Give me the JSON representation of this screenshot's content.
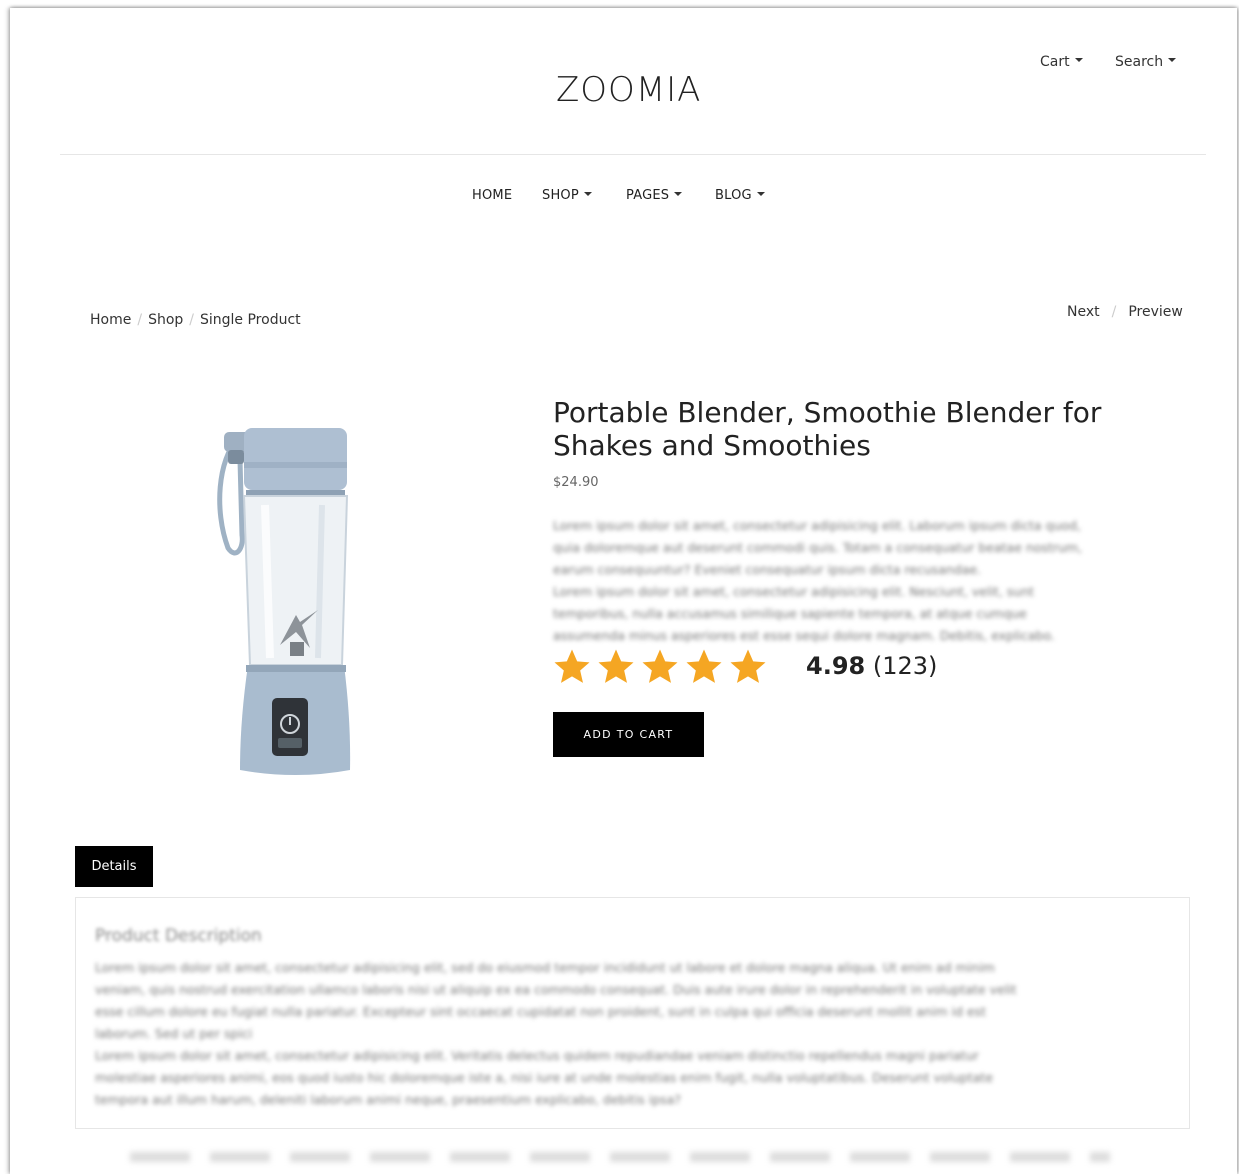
{
  "header": {
    "logo": "ZOOMIA",
    "cart_label": "Cart",
    "search_label": "Search"
  },
  "nav": {
    "items": [
      {
        "label": "HOME",
        "dropdown": false
      },
      {
        "label": "SHOP",
        "dropdown": true
      },
      {
        "label": "PAGES",
        "dropdown": true
      },
      {
        "label": "BLOG",
        "dropdown": true
      }
    ]
  },
  "breadcrumb": [
    "Home",
    "Shop",
    "Single Product"
  ],
  "pager": {
    "next": "Next",
    "prev": "Preview"
  },
  "product": {
    "title": "Portable Blender, Smoothie Blender for Shakes and Smoothies",
    "price": "$24.90",
    "description": [
      "Lorem ipsum dolor sit amet, consectetur adipisicing elit. Laborum ipsum dicta quod,",
      "quia doloremque aut deserunt commodi quis. Totam a consequatur beatae nostrum,",
      "earum consequuntur? Eveniet consequatur ipsum dicta recusandae.",
      "Lorem ipsum dolor sit amet, consectetur adipisicing elit. Nesciunt, velit, sunt",
      "temporibus, nulla accusamus similique sapiente tempora, at atque cumque",
      "assumenda minus asperiores est esse sequi dolore magnam. Debitis, explicabo."
    ],
    "rating": "4.98",
    "rating_stars": 5,
    "review_count": "(123)",
    "add_to_cart": "ADD TO CART",
    "accent_color": "#f5a623"
  },
  "tabs": {
    "details_label": "Details"
  },
  "details": {
    "heading": "Product Description",
    "lines": [
      "Lorem ipsum dolor sit amet, consectetur adipisicing elit, sed do eiusmod tempor incididunt ut labore et dolore magna aliqua. Ut enim ad minim",
      "veniam, quis nostrud exercitation ullamco laboris nisi ut aliquip ex ea commodo consequat. Duis aute irure dolor in reprehenderit in voluptate velit",
      "esse cillum dolore eu fugiat nulla pariatur. Excepteur sint occaecat cupidatat non proident, sunt in culpa qui officia deserunt mollit anim id est",
      "laborum. Sed ut per spici",
      "Lorem ipsum dolor sit amet, consectetur adipisicing elit. Veritatis delectus quidem repudiandae veniam distinctio repellendus magni pariatur",
      "molestiae asperiores animi, eos quod iusto hic doloremque iste a, nisi iure at unde molestias enim fugit, nulla voluptatibus. Deserunt voluptate",
      "tempora aut illum harum, deleniti laborum animi neque, praesentium explicabo, debitis ipsa?"
    ]
  }
}
